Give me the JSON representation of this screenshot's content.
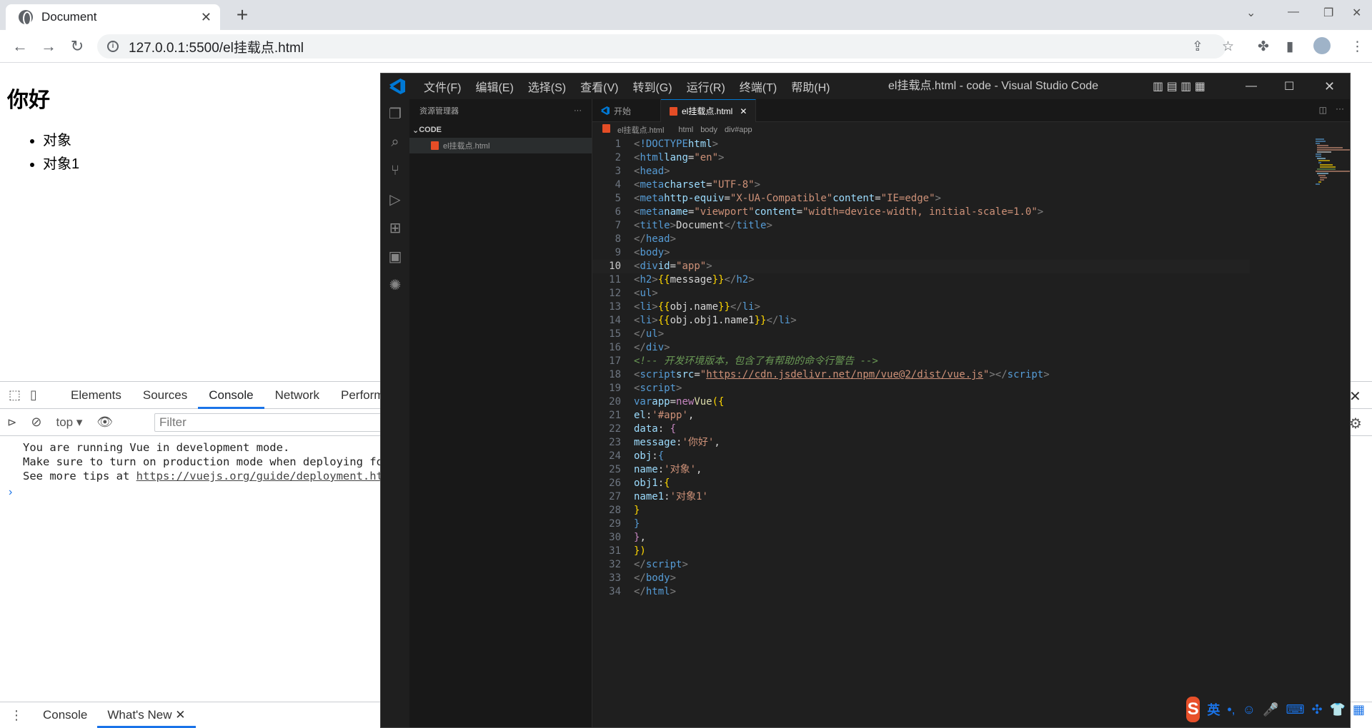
{
  "browser": {
    "tab_title": "Document",
    "url": "127.0.0.1:5500/el挂载点.html"
  },
  "page": {
    "heading": "你好",
    "items": [
      "对象",
      "对象1"
    ]
  },
  "devtools": {
    "tabs": [
      "Elements",
      "Sources",
      "Console",
      "Network",
      "Perform"
    ],
    "active_tab": "Console",
    "context": "top",
    "filter_placeholder": "Filter",
    "messages": [
      "You are running Vue in development mode.",
      "Make sure to turn on production mode when deploying for",
      "See more tips at "
    ],
    "link": "https://vuejs.org/guide/deployment.htm",
    "drawer_tabs": [
      "Console",
      "What's New"
    ]
  },
  "vscode": {
    "menus": [
      "文件(F)",
      "编辑(E)",
      "选择(S)",
      "查看(V)",
      "转到(G)",
      "运行(R)",
      "终端(T)",
      "帮助(H)"
    ],
    "window_title": "el挂载点.html - code - Visual Studio Code",
    "explorer_title": "资源管理器",
    "folder": "CODE",
    "file": "el挂载点.html",
    "tabs": [
      "开始",
      "el挂载点.html"
    ],
    "breadcrumbs": [
      "el挂载点.html",
      "html",
      "body",
      "div#app"
    ]
  },
  "ime": {
    "lang": "英"
  },
  "colors": {
    "vscode_bg": "#1f1f1f",
    "accent": "#1a73e8"
  }
}
